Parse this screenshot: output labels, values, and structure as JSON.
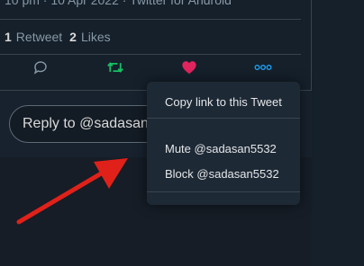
{
  "tweet": {
    "meta": "10 pm · 10 Apr 2022 · Twitter for Android",
    "retweets_count": "1",
    "retweets_label": "Retweet",
    "likes_count": "2",
    "likes_label": "Likes"
  },
  "actions": {
    "reply_icon": "reply-icon",
    "retweet_icon": "retweet-icon",
    "like_icon": "heart-icon",
    "more_icon": "more-icon"
  },
  "reply": {
    "placeholder": "Reply to @sadasan5532"
  },
  "menu": {
    "items": [
      "Copy link to this Tweet",
      "Mute @sadasan5532",
      "Block @sadasan5532"
    ]
  },
  "colors": {
    "retweet": "#17bf63",
    "like": "#e0245e",
    "more": "#1da1f2",
    "annotation_arrow": "#e0211a"
  }
}
